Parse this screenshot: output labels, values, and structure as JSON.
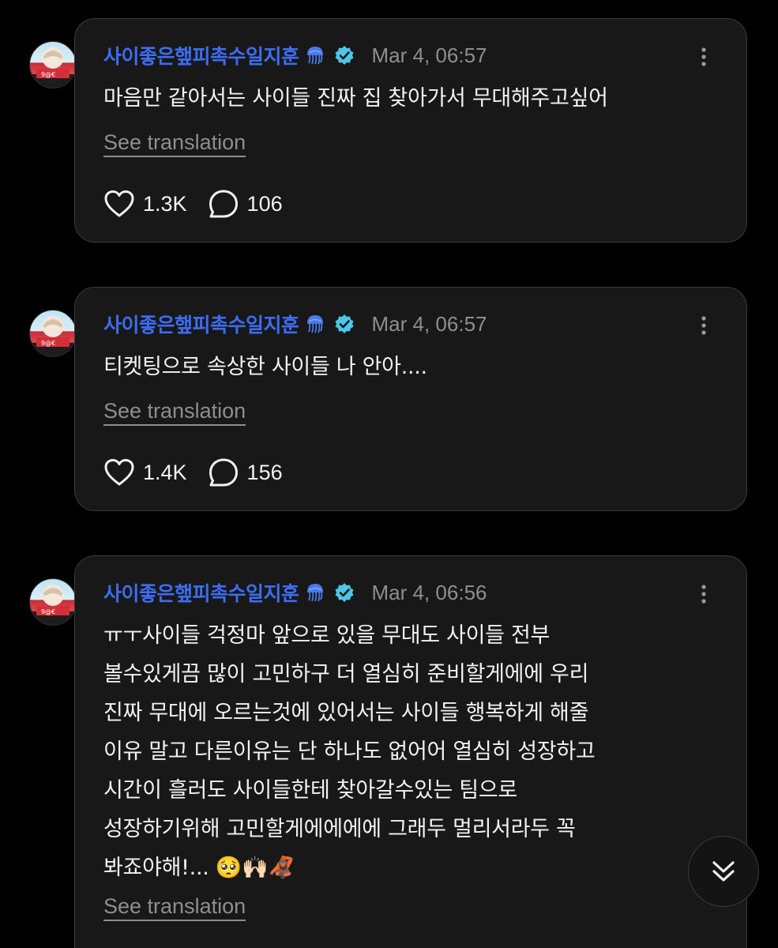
{
  "colors": {
    "background": "#000000",
    "card": "#181818",
    "border": "#3a3a3a",
    "username": "#3d6cf2",
    "verified": "#4dc6e8",
    "muted": "#8e8e8e",
    "text": "#f2f2f2"
  },
  "posts": [
    {
      "username": "사이좋은햎피촉수일지훈",
      "username_icon": "jellyfish-icon",
      "verified_icon": "verified-badge-icon",
      "timestamp": "Mar 4, 06:57",
      "text": "마음만 같아서는 사이들 진짜 집 찾아가서 무대해주고싶어",
      "translate_label": "See translation",
      "likes": "1.3K",
      "comments": "106"
    },
    {
      "username": "사이좋은햎피촉수일지훈",
      "username_icon": "jellyfish-icon",
      "verified_icon": "verified-badge-icon",
      "timestamp": "Mar 4, 06:57",
      "text": "티켓팅으로 속상한 사이들 나 안아....",
      "translate_label": "See translation",
      "likes": "1.4K",
      "comments": "156"
    },
    {
      "username": "사이좋은햎피촉수일지훈",
      "username_icon": "jellyfish-icon",
      "verified_icon": "verified-badge-icon",
      "timestamp": "Mar 4, 06:56",
      "text": "ㅠㅜ사이들 걱정마 앞으로 있을 무대도 사이들 전부\n볼수있게끔 많이 고민하구 더 열심히 준비할게에에 우리\n진짜 무대에 오르는것에 있어서는 사이들 행복하게 해줄\n이유 말고 다른이유는 단 하나도 없어어 열심히 성장하고\n시간이 흘러도 사이들한테 찾아갈수있는 팀으로\n성장하기위해 고민할게에에에에 그래두 멀리서라두 꼭\n봐죠야해!... 🥺🙌🏻🦧",
      "translate_label": "See translation"
    }
  ],
  "scroll_button_icon": "double-chevron-down-icon"
}
